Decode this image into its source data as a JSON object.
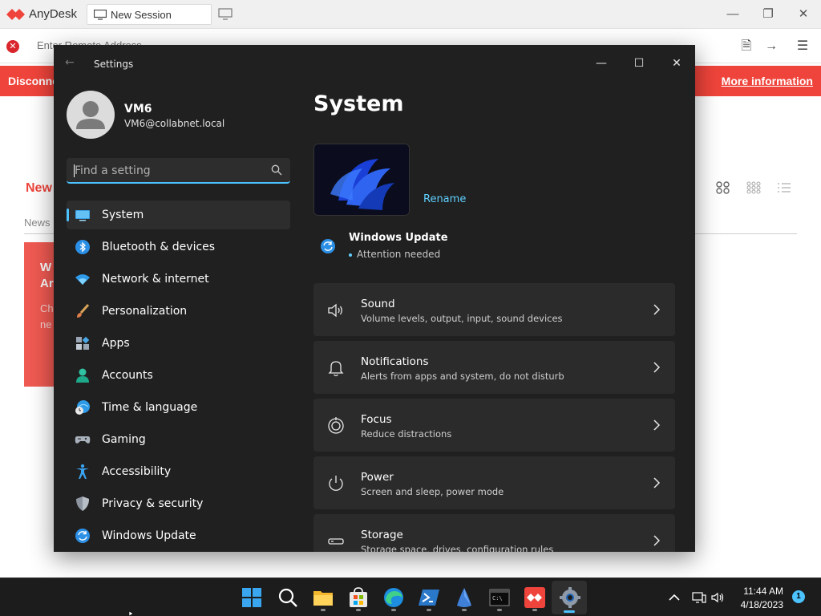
{
  "anydesk": {
    "app_name": "AnyDesk",
    "tab_label": "New Session",
    "address_placeholder": "Enter Remote Address",
    "banner_text": "Disconnected",
    "banner_link": "More information",
    "news_heading": "New",
    "news_tab": "News",
    "card_title": "W\nAr",
    "card_sub": "Ch\nne",
    "brand_color": "#ef443b"
  },
  "settings": {
    "window_title": "Settings",
    "user": {
      "name": "VM6",
      "email": "VM6@collabnet.local"
    },
    "search_placeholder": "Find a setting",
    "nav": [
      {
        "label": "System",
        "icon": "system-icon",
        "active": true
      },
      {
        "label": "Bluetooth & devices",
        "icon": "bluetooth-icon"
      },
      {
        "label": "Network & internet",
        "icon": "wifi-icon"
      },
      {
        "label": "Personalization",
        "icon": "brush-icon"
      },
      {
        "label": "Apps",
        "icon": "apps-icon"
      },
      {
        "label": "Accounts",
        "icon": "person-icon"
      },
      {
        "label": "Time & language",
        "icon": "globe-clock-icon"
      },
      {
        "label": "Gaming",
        "icon": "gamepad-icon"
      },
      {
        "label": "Accessibility",
        "icon": "accessibility-icon"
      },
      {
        "label": "Privacy & security",
        "icon": "shield-icon"
      },
      {
        "label": "Windows Update",
        "icon": "update-icon"
      }
    ],
    "page_title": "System",
    "rename_label": "Rename",
    "windows_update": {
      "title": "Windows Update",
      "status": "Attention needed"
    },
    "cards": [
      {
        "title": "Sound",
        "subtitle": "Volume levels, output, input, sound devices",
        "icon": "speaker-icon"
      },
      {
        "title": "Notifications",
        "subtitle": "Alerts from apps and system, do not disturb",
        "icon": "bell-icon"
      },
      {
        "title": "Focus",
        "subtitle": "Reduce distractions",
        "icon": "focus-icon"
      },
      {
        "title": "Power",
        "subtitle": "Screen and sleep, power mode",
        "icon": "power-icon"
      },
      {
        "title": "Storage",
        "subtitle": "Storage space, drives, configuration rules",
        "icon": "storage-icon"
      }
    ],
    "accent_color": "#4cc2ff"
  },
  "taskbar": {
    "apps": [
      "start-icon",
      "search-icon",
      "file-explorer-icon",
      "store-icon",
      "edge-icon",
      "powershell-icon",
      "azure-data-studio-icon",
      "terminal-icon",
      "anydesk-icon",
      "settings-icon"
    ],
    "time": "11:44 AM",
    "date": "4/18/2023",
    "notification_count": "1"
  }
}
